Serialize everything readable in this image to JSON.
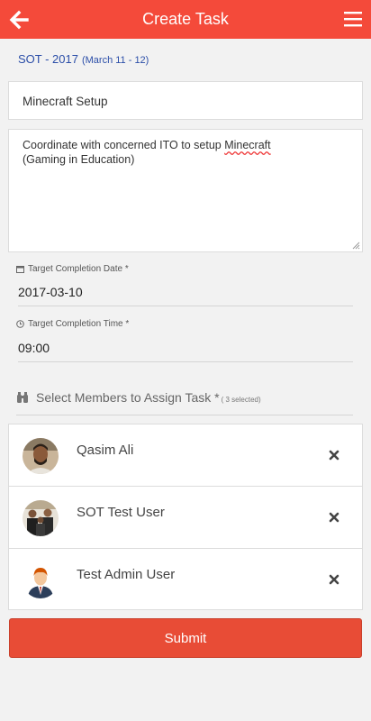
{
  "header": {
    "title": "Create Task",
    "back_icon": "arrow-left-icon",
    "menu_icon": "hamburger-menu-icon",
    "color": "#f44a3a"
  },
  "event": {
    "name": "SOT - 2017",
    "dates": "(March 11 - 12)"
  },
  "form": {
    "title_value": "Minecraft Setup",
    "description_before": "Coordinate with concerned ITO to setup ",
    "description_misspelled": "Minecraft",
    "description_after": "(Gaming in Education)",
    "date_label": "Target Completion Date *",
    "date_value": "2017-03-10",
    "time_label": "Target Completion Time *",
    "time_value": "09:00",
    "members_label": "Select Members to Assign Task *",
    "members_selected": "( 3 selected)"
  },
  "members": [
    {
      "name": "Qasim Ali",
      "avatar": "person-photo"
    },
    {
      "name": "SOT Test User",
      "avatar": "group-photo"
    },
    {
      "name": "Test Admin User",
      "avatar": "admin-avatar"
    }
  ],
  "submit_label": "Submit",
  "colors": {
    "accent": "#f44a3a",
    "link": "#2b4ea8",
    "submit": "#e84c36"
  }
}
